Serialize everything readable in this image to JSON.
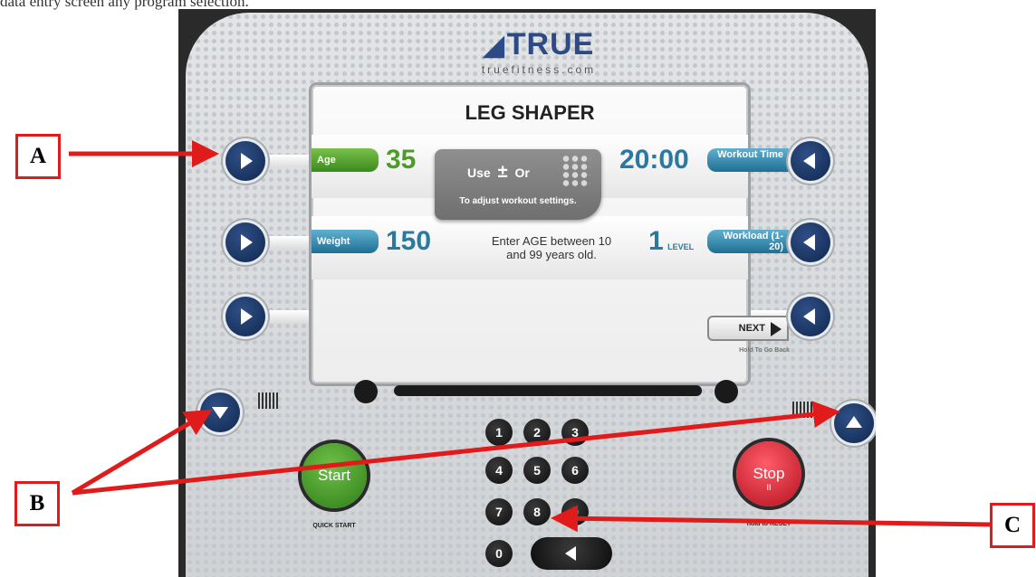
{
  "caption": "data entry screen any program selection.",
  "brand": {
    "name": "TRUE",
    "url": "truefitness.com"
  },
  "screen": {
    "title": "LEG SHAPER",
    "age_label": "Age",
    "age_value": "35",
    "weight_label": "Weight",
    "weight_value": "150",
    "time_label": "Workout Time",
    "time_value": "20:00",
    "workload_label": "Workload (1-20)",
    "level_value": "1",
    "level_word": "LEVEL",
    "popup_use": "Use",
    "popup_plus_minus": "±",
    "popup_or": "Or",
    "popup_hint": "To adjust workout settings.",
    "message": "Enter AGE between 10 and 99 years old.",
    "next_label": "NEXT",
    "hold_back": "Hold To Go Back"
  },
  "keypad": {
    "keys": [
      "1",
      "2",
      "3",
      "4",
      "5",
      "6",
      "7",
      "8",
      "9",
      "0"
    ]
  },
  "buttons": {
    "start_label": "Start",
    "start_caption": "QUICK START",
    "stop_label": "Stop",
    "stop_pause": "II",
    "stop_caption": "hold to RESET"
  },
  "callouts": {
    "a": "A",
    "b": "B",
    "c": "C"
  },
  "colors": {
    "callout_red": "#e01b1b",
    "button_navy": "#1b3566",
    "start_green": "#3f9a24",
    "stop_red": "#d81e2c"
  }
}
